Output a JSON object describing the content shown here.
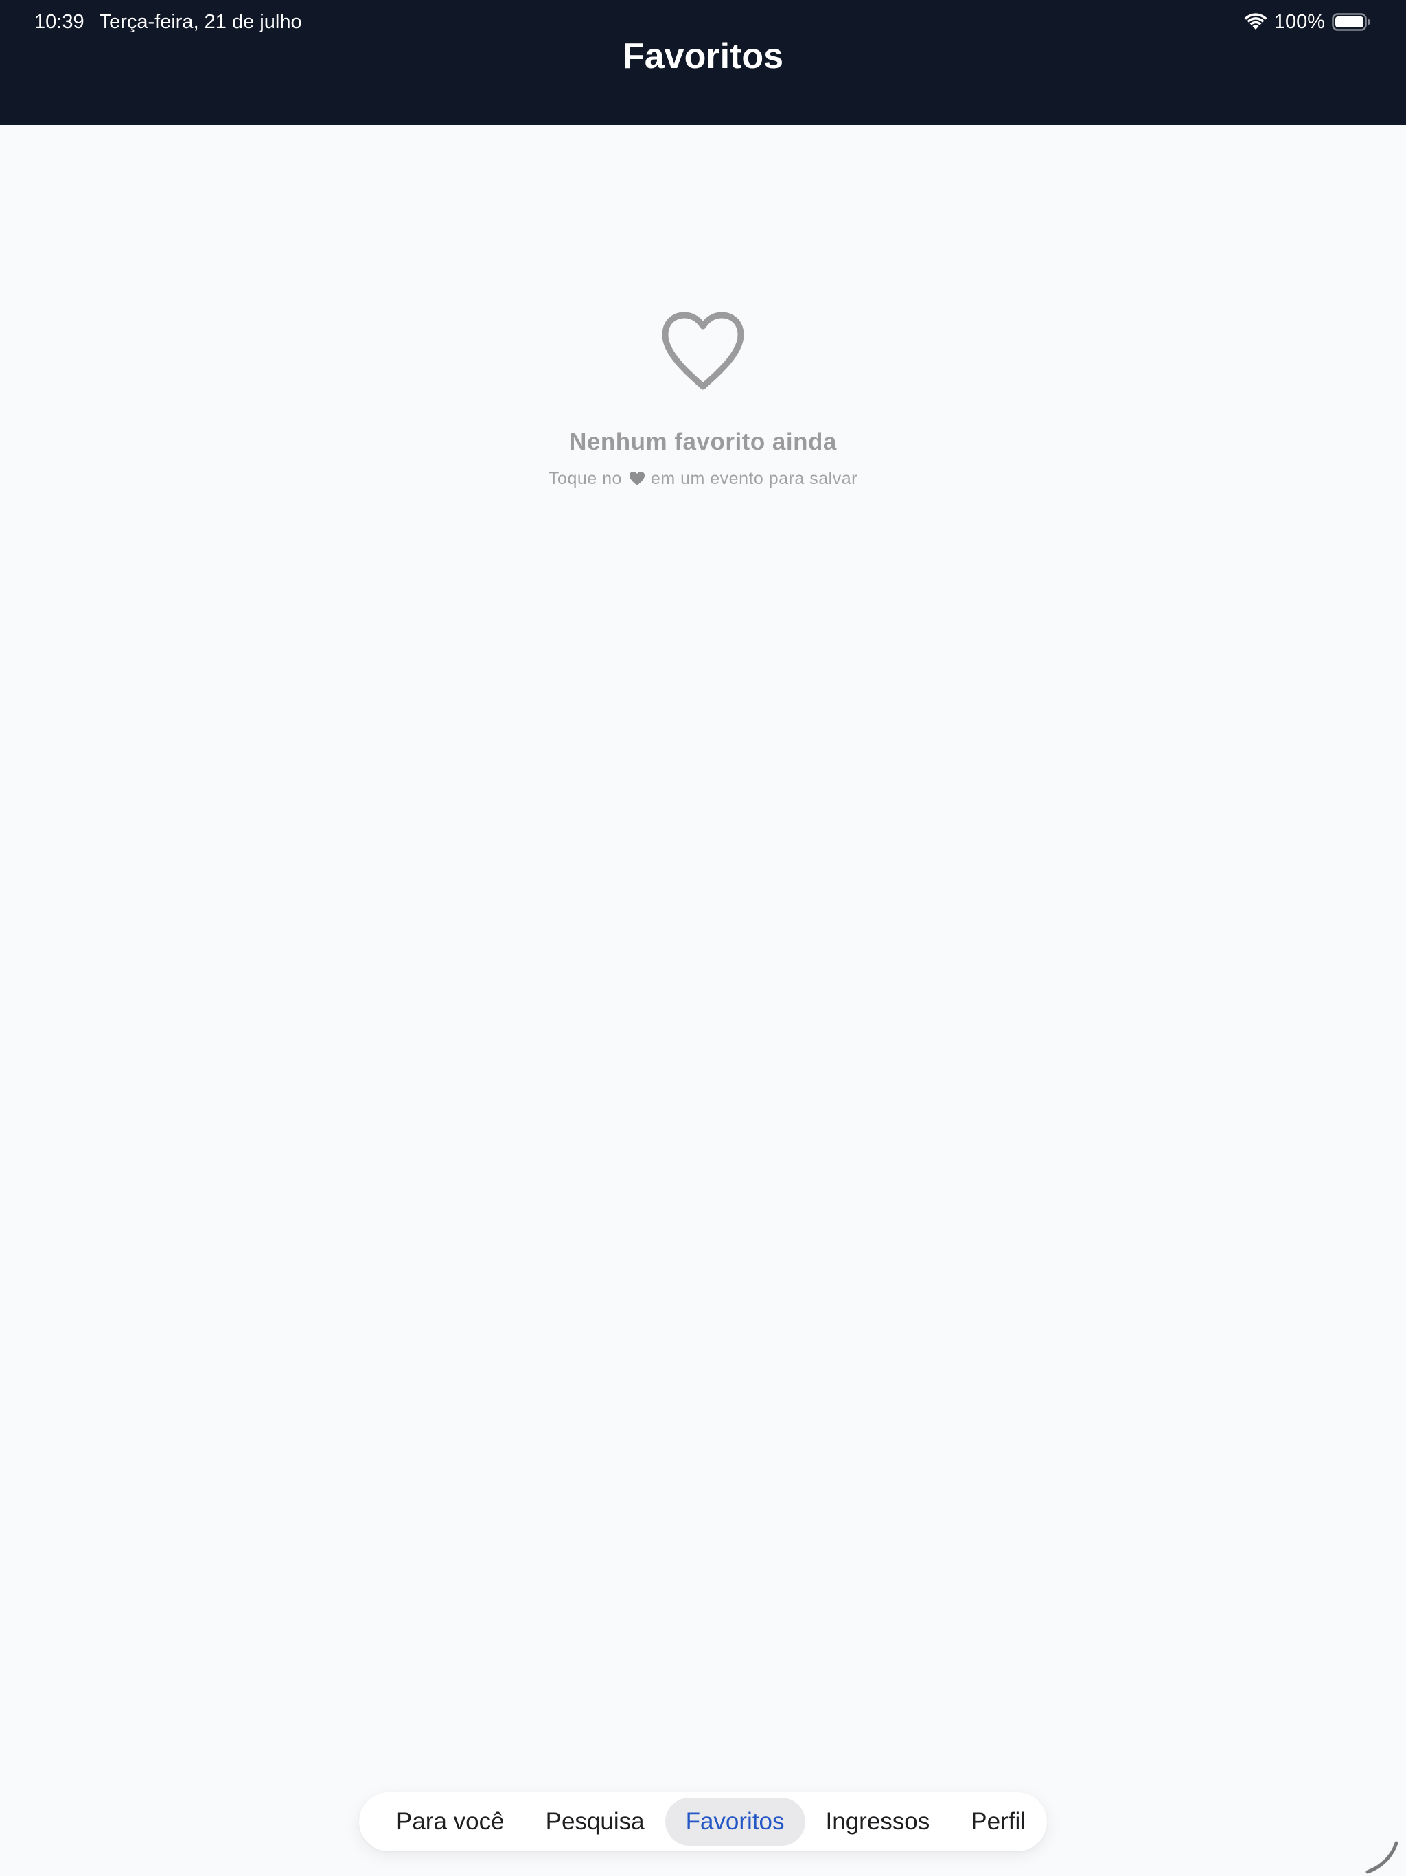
{
  "status_bar": {
    "time": "10:39",
    "date": "Terça-feira, 21 de julho",
    "battery_percent": "100%",
    "wifi_icon": "wifi-icon",
    "battery_icon": "battery-icon"
  },
  "header": {
    "title": "Favoritos",
    "background_color": "#101727"
  },
  "empty_state": {
    "icon": "heart-outline-icon",
    "title": "Nenhum favorito ainda",
    "subtitle_before": "Toque no",
    "subtitle_icon": "heart-icon",
    "subtitle_after": "em um evento para salvar",
    "text_color": "#9b9b9d"
  },
  "tab_bar": {
    "active_index": 2,
    "active_color": "#2457c5",
    "tabs": [
      {
        "label": "Para você"
      },
      {
        "label": "Pesquisa"
      },
      {
        "label": "Favoritos"
      },
      {
        "label": "Ingressos"
      },
      {
        "label": "Perfil"
      }
    ]
  }
}
